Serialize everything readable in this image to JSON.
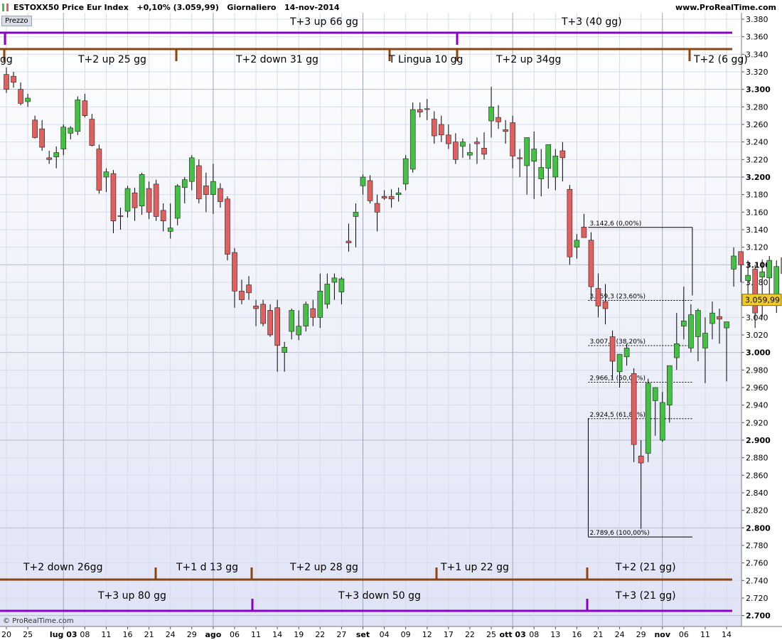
{
  "header": {
    "symbol": "ESTOXX50 Price Eur Index",
    "change": "+0,10% (3.059,99)",
    "period": "Giornaliero",
    "date": "14-nov-2014",
    "site": "www.ProRealTime.com"
  },
  "panel_label": "Prezzo",
  "footer": "© ProRealTime.com",
  "colors": {
    "up_candle": "#44c044",
    "down_candle": "#e06060",
    "cycle_t2": "#8b4513",
    "cycle_t3": "#8b00c8",
    "price_label_bg": "#f0c830"
  },
  "chart_data": {
    "type": "candlestick",
    "title": "ESTOXX50 Price Eur Index",
    "ylim": [
      2690,
      3390
    ],
    "y_ticks": [
      "2.700",
      "2.720",
      "2.740",
      "2.760",
      "2.780",
      "2.800",
      "2.820",
      "2.840",
      "2.860",
      "2.880",
      "2.900",
      "2.920",
      "2.940",
      "2.960",
      "2.980",
      "3.000",
      "3.020",
      "3.040",
      "3.060",
      "3.080",
      "3.100",
      "3.120",
      "3.140",
      "3.160",
      "3.180",
      "3.200",
      "3.220",
      "3.240",
      "3.260",
      "3.280",
      "3.300",
      "3.320",
      "3.340",
      "3.360",
      "3.380"
    ],
    "x_ticks": [
      {
        "i": 0,
        "label": "20"
      },
      {
        "i": 3,
        "label": "25"
      },
      {
        "i": 8,
        "label": "lug 03"
      },
      {
        "i": 11,
        "label": "08"
      },
      {
        "i": 14,
        "label": "11"
      },
      {
        "i": 17,
        "label": "16"
      },
      {
        "i": 20,
        "label": "21"
      },
      {
        "i": 23,
        "label": "24"
      },
      {
        "i": 26,
        "label": "29"
      },
      {
        "i": 29,
        "label": "ago"
      },
      {
        "i": 32,
        "label": "06"
      },
      {
        "i": 35,
        "label": "11"
      },
      {
        "i": 38,
        "label": "14"
      },
      {
        "i": 41,
        "label": "19"
      },
      {
        "i": 44,
        "label": "22"
      },
      {
        "i": 47,
        "label": "27"
      },
      {
        "i": 50,
        "label": "set"
      },
      {
        "i": 53,
        "label": "04"
      },
      {
        "i": 56,
        "label": "09"
      },
      {
        "i": 59,
        "label": "12"
      },
      {
        "i": 62,
        "label": "17"
      },
      {
        "i": 65,
        "label": "22"
      },
      {
        "i": 68,
        "label": "25"
      },
      {
        "i": 71,
        "label": "ott 03"
      },
      {
        "i": 74,
        "label": "08"
      },
      {
        "i": 77,
        "label": "13"
      },
      {
        "i": 80,
        "label": "16"
      },
      {
        "i": 83,
        "label": "21"
      },
      {
        "i": 86,
        "label": "24"
      },
      {
        "i": 89,
        "label": "29"
      },
      {
        "i": 92,
        "label": "nov"
      },
      {
        "i": 95,
        "label": "06"
      },
      {
        "i": 98,
        "label": "11"
      },
      {
        "i": 101,
        "label": "14"
      }
    ],
    "ohlc": [
      [
        3317,
        3325,
        3296,
        3300
      ],
      [
        3315,
        3320,
        3302,
        3308
      ],
      [
        3300,
        3308,
        3282,
        3284
      ],
      [
        3286,
        3295,
        3280,
        3290
      ],
      [
        3265,
        3270,
        3244,
        3245
      ],
      [
        3255,
        3265,
        3230,
        3234
      ],
      [
        3222,
        3230,
        3215,
        3220
      ],
      [
        3223,
        3235,
        3210,
        3228
      ],
      [
        3232,
        3260,
        3225,
        3257
      ],
      [
        3250,
        3258,
        3243,
        3256
      ],
      [
        3252,
        3292,
        3248,
        3288
      ],
      [
        3287,
        3295,
        3268,
        3270
      ],
      [
        3266,
        3272,
        3235,
        3236
      ],
      [
        3232,
        3237,
        3181,
        3185
      ],
      [
        3200,
        3210,
        3183,
        3206
      ],
      [
        3204,
        3208,
        3136,
        3150
      ],
      [
        3156,
        3165,
        3140,
        3155
      ],
      [
        3161,
        3190,
        3154,
        3187
      ],
      [
        3182,
        3188,
        3150,
        3165
      ],
      [
        3167,
        3205,
        3157,
        3203
      ],
      [
        3187,
        3195,
        3152,
        3160
      ],
      [
        3192,
        3197,
        3150,
        3155
      ],
      [
        3162,
        3170,
        3138,
        3150
      ],
      [
        3138,
        3170,
        3130,
        3142
      ],
      [
        3153,
        3192,
        3145,
        3190
      ],
      [
        3188,
        3200,
        3170,
        3197
      ],
      [
        3195,
        3225,
        3185,
        3222
      ],
      [
        3213,
        3220,
        3170,
        3175
      ],
      [
        3190,
        3205,
        3160,
        3180
      ],
      [
        3180,
        3215,
        3158,
        3195
      ],
      [
        3187,
        3193,
        3165,
        3172
      ],
      [
        3175,
        3178,
        3105,
        3112
      ],
      [
        3114,
        3119,
        3051,
        3070
      ],
      [
        3070,
        3083,
        3055,
        3060
      ],
      [
        3077,
        3087,
        3060,
        3068
      ],
      [
        3053,
        3060,
        3030,
        3050
      ],
      [
        3055,
        3060,
        3030,
        3033
      ],
      [
        3048,
        3055,
        3018,
        3020
      ],
      [
        3051,
        3060,
        2978,
        3008
      ],
      [
        3000,
        3012,
        2978,
        3006
      ],
      [
        3024,
        3050,
        3015,
        3048
      ],
      [
        3020,
        3048,
        3014,
        3030
      ],
      [
        3030,
        3058,
        3024,
        3055
      ],
      [
        3050,
        3060,
        3030,
        3040
      ],
      [
        3040,
        3090,
        3028,
        3070
      ],
      [
        3055,
        3090,
        3050,
        3078
      ],
      [
        3080,
        3090,
        3060,
        3085
      ],
      [
        3069,
        3086,
        3055,
        3084
      ],
      [
        3127,
        3147,
        3115,
        3125
      ],
      [
        3155,
        3170,
        3120,
        3160
      ],
      [
        3190,
        3203,
        3180,
        3200
      ],
      [
        3196,
        3202,
        3170,
        3173
      ],
      [
        3170,
        3180,
        3138,
        3160
      ],
      [
        3178,
        3185,
        3174,
        3176
      ],
      [
        3178,
        3186,
        3165,
        3175
      ],
      [
        3180,
        3188,
        3172,
        3182
      ],
      [
        3192,
        3225,
        3185,
        3221
      ],
      [
        3209,
        3285,
        3205,
        3277
      ],
      [
        3277,
        3285,
        3268,
        3274
      ],
      [
        3278,
        3289,
        3265,
        3277
      ],
      [
        3266,
        3275,
        3238,
        3247
      ],
      [
        3260,
        3270,
        3240,
        3248
      ],
      [
        3248,
        3260,
        3232,
        3238
      ],
      [
        3240,
        3250,
        3215,
        3220
      ],
      [
        3235,
        3244,
        3222,
        3240
      ],
      [
        3225,
        3238,
        3220,
        3228
      ],
      [
        3240,
        3245,
        3215,
        3238
      ],
      [
        3233,
        3251,
        3220,
        3226
      ],
      [
        3264,
        3303,
        3245,
        3280
      ],
      [
        3268,
        3282,
        3255,
        3263
      ],
      [
        3254,
        3265,
        3238,
        3252
      ],
      [
        3262,
        3270,
        3210,
        3224
      ],
      [
        3222,
        3232,
        3200,
        3221
      ],
      [
        3213,
        3232,
        3180,
        3245
      ],
      [
        3218,
        3252,
        3175,
        3232
      ],
      [
        3198,
        3232,
        3178,
        3211
      ],
      [
        3210,
        3228,
        3187,
        3237
      ],
      [
        3200,
        3232,
        3185,
        3224
      ],
      [
        3230,
        3240,
        3195,
        3222
      ],
      [
        3186,
        3191,
        3100,
        3109
      ],
      [
        3120,
        3135,
        3107,
        3128
      ],
      [
        3143,
        3158,
        3132,
        3131
      ],
      [
        3128,
        3137,
        3060,
        3075
      ],
      [
        3073,
        3090,
        3040,
        3053
      ],
      [
        3058,
        3078,
        3032,
        3050
      ],
      [
        3018,
        3025,
        2970,
        2990
      ],
      [
        2978,
        2998,
        2960,
        2998
      ],
      [
        2995,
        3010,
        2985,
        3005
      ],
      [
        2976,
        2982,
        2875,
        2895
      ],
      [
        2882,
        2900,
        2799,
        2874
      ],
      [
        2885,
        2970,
        2875,
        2965
      ],
      [
        2945,
        2960,
        2905,
        2960
      ],
      [
        2900,
        2955,
        2898,
        2943
      ],
      [
        2940,
        2985,
        2920,
        2985
      ],
      [
        2994,
        3045,
        2980,
        3010
      ],
      [
        3030,
        3075,
        3015,
        3036
      ],
      [
        3005,
        3055,
        3000,
        3043
      ],
      [
        3018,
        3050,
        2990,
        3048
      ],
      [
        3005,
        3040,
        2965,
        3022
      ],
      [
        3033,
        3058,
        3015,
        3045
      ],
      [
        3041,
        3050,
        3010,
        3038
      ],
      [
        3028,
        3035,
        2967,
        3035
      ],
      [
        3095,
        3120,
        3075,
        3110
      ],
      [
        3115,
        3110,
        3080,
        3100
      ],
      [
        3082,
        3105,
        3057,
        3088
      ],
      [
        3095,
        3100,
        3028,
        3045
      ],
      [
        3086,
        3106,
        3040,
        3092
      ],
      [
        3085,
        3110,
        3055,
        3105
      ],
      [
        3058,
        3105,
        3045,
        3098
      ],
      [
        3108,
        3115,
        3065,
        3090
      ],
      [
        3103,
        3106,
        3036,
        3048
      ],
      [
        3035,
        3070,
        3025,
        3058
      ],
      [
        3053,
        3075,
        3040,
        3060
      ]
    ],
    "last_price": "3.059,99",
    "fibonacci": [
      {
        "label": "3.142,6 (0,00%)",
        "value": 3142.6
      },
      {
        "label": "3.059,3 (23,60%)",
        "value": 3059.3
      },
      {
        "label": "3.007,8 (38,20%)",
        "value": 3007.8
      },
      {
        "label": "2.966,1 (50,00%)",
        "value": 2966.1
      },
      {
        "label": "2.924,5 (61,80%)",
        "value": 2924.5
      },
      {
        "label": "2.789,6 (100,00%)",
        "value": 2789.6
      }
    ],
    "cycles_top": {
      "t3_line": [
        {
          "label": "T+3 up 66 gg"
        },
        {
          "label": "T+3 (40 gg)"
        }
      ],
      "t2_line": [
        {
          "label": "gg"
        },
        {
          "label": "T+2 up 25 gg"
        },
        {
          "label": "T+2 down 31 gg"
        },
        {
          "label": "T Lingua 10 gg"
        },
        {
          "label": "T+2 up 34gg"
        },
        {
          "label": "T+2 (6 gg)"
        }
      ]
    },
    "cycles_bottom": {
      "t2_line": [
        {
          "label": "T+2  down 26gg"
        },
        {
          "label": "T+1 d 13 gg"
        },
        {
          "label": "T+2 up 28 gg"
        },
        {
          "label": "T+1 up 22 gg"
        },
        {
          "label": "T+2 (21 gg)"
        }
      ],
      "t3_line": [
        {
          "label": "T+3 up 80 gg"
        },
        {
          "label": "T+3 down 50 gg"
        },
        {
          "label": "T+3 (21 gg)"
        }
      ]
    }
  }
}
